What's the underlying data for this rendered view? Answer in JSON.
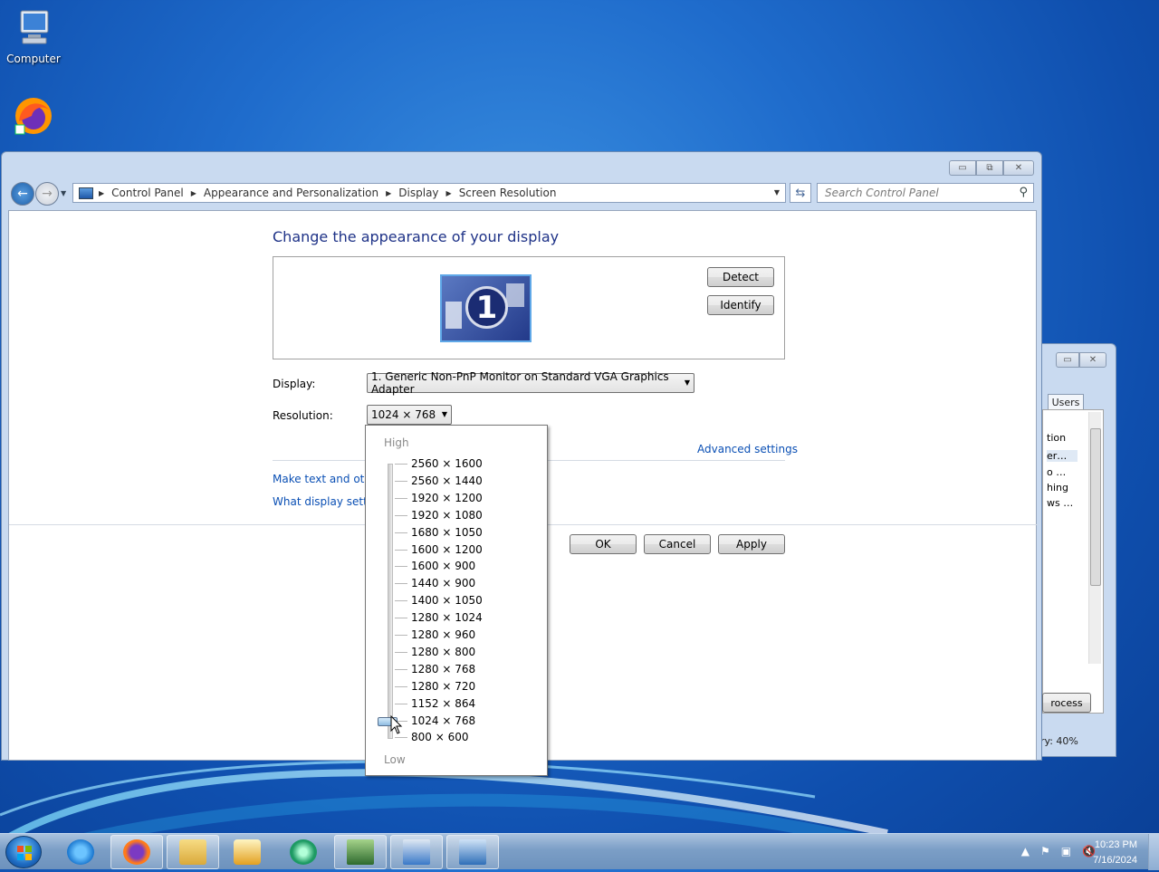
{
  "desktop": {
    "icons": [
      {
        "label": "Computer"
      },
      {
        "label": "Firefox"
      }
    ]
  },
  "window": {
    "caption_buttons": {
      "minimize": "▭",
      "maximize": "⧉",
      "close": "✕"
    },
    "breadcrumb": [
      "Control Panel",
      "Appearance and Personalization",
      "Display",
      "Screen Resolution"
    ],
    "search_placeholder": "Search Control Panel",
    "heading": "Change the appearance of your display",
    "monitor_number": "1",
    "detect_label": "Detect",
    "identify_label": "Identify",
    "display_label": "Display:",
    "display_value": "1. Generic Non-PnP Monitor on Standard VGA Graphics Adapter",
    "resolution_label": "Resolution:",
    "resolution_value": "1024 × 768",
    "advanced_link": "Advanced settings",
    "make_text_link": "Make text and other",
    "what_display_link": "What display setting",
    "ok_label": "OK",
    "cancel_label": "Cancel",
    "apply_label": "Apply"
  },
  "resolution_dropdown": {
    "high_label": "High",
    "low_label": "Low",
    "options": [
      "2560 × 1600",
      "2560 × 1440",
      "1920 × 1200",
      "1920 × 1080",
      "1680 × 1050",
      "1600 × 1200",
      "1600 × 900",
      "1440 × 900",
      "1400 × 1050",
      "1280 × 1024",
      "1280 × 960",
      "1280 × 800",
      "1280 × 768",
      "1280 × 720",
      "1152 × 864",
      "1024 × 768",
      "800 × 600"
    ],
    "selected": "1024 × 768"
  },
  "back_window": {
    "tab": "Users",
    "rows": [
      "tion",
      "er…",
      "o …",
      "hing",
      "ws …"
    ],
    "button": "rocess",
    "status": "ry: 40%"
  },
  "taskbar": {
    "clock_time": "10:23 PM",
    "clock_date": "7/16/2024",
    "apps": [
      "internet-explorer-icon",
      "firefox-icon",
      "file-explorer-icon",
      "media-player-icon",
      "media-center-icon",
      "task-manager-icon",
      "display-settings-icon",
      "control-panel-icon"
    ]
  }
}
